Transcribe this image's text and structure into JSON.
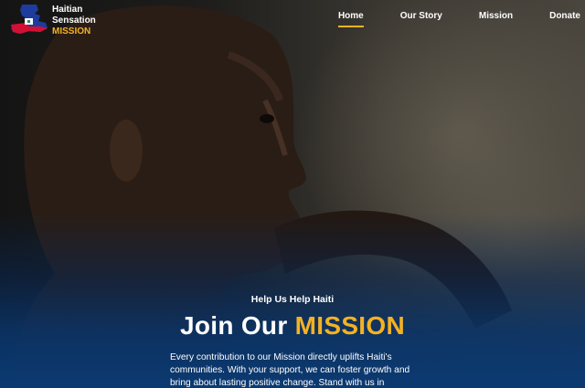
{
  "brand": {
    "line1": "Haitian",
    "line2": "Sensation",
    "line3": "MISSION",
    "logo_icon": "haiti-map-flag-icon"
  },
  "nav": {
    "items": [
      {
        "label": "Home",
        "active": true
      },
      {
        "label": "Our Story",
        "active": false
      },
      {
        "label": "Mission",
        "active": false
      },
      {
        "label": "Donate",
        "active": false
      }
    ]
  },
  "hero": {
    "eyebrow": "Help Us Help Haiti",
    "headline_main": "Join Our",
    "headline_accent": "MISSION",
    "description": "Every contribution to our Mission directly uplifts Haiti's communities. With your support, we can foster growth and bring about lasting positive change. Stand with us in"
  },
  "colors": {
    "accent": "#f4b223",
    "overlay_blue": "#0b3a72",
    "text": "#ffffff"
  }
}
